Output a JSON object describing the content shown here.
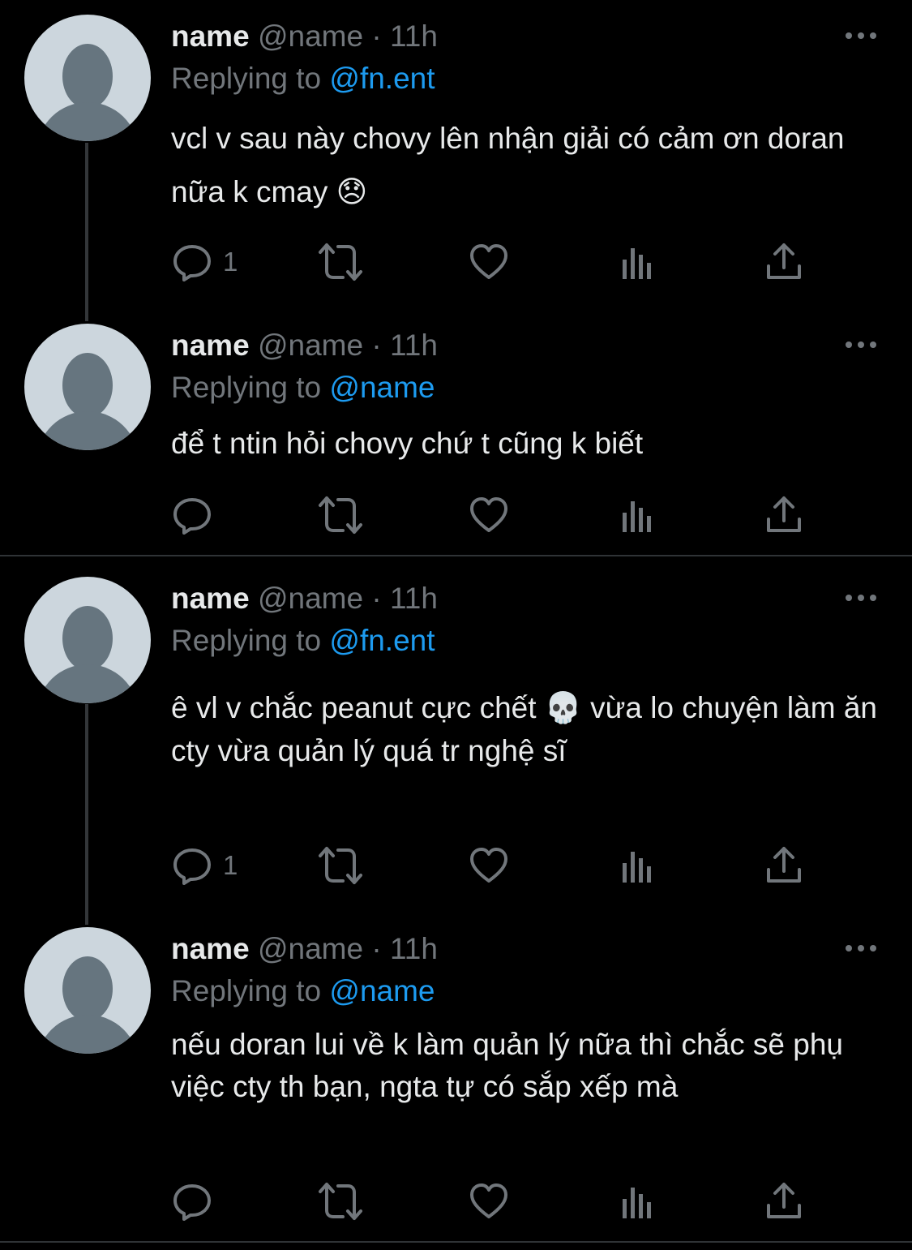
{
  "tweets": [
    {
      "name": "name",
      "handle": "@name",
      "separator": "·",
      "time": "11h",
      "replying_prefix": "Replying to",
      "replying_to": "@fn.ent",
      "text": "vcl v sau này chovy lên nhận giải có cảm ơn doran nữa k cmay 😞",
      "reply_count": "1"
    },
    {
      "name": "name",
      "handle": "@name",
      "separator": "·",
      "time": "11h",
      "replying_prefix": "Replying to",
      "replying_to": "@name",
      "text": "để t ntin hỏi chovy chứ t cũng k biết",
      "reply_count": ""
    },
    {
      "name": "name",
      "handle": "@name",
      "separator": "·",
      "time": "11h",
      "replying_prefix": "Replying to",
      "replying_to": "@fn.ent",
      "text": "ê vl v chắc peanut cực chết 💀  vừa lo chuyện làm ăn cty vừa quản lý quá tr nghệ sĩ",
      "reply_count": "1"
    },
    {
      "name": "name",
      "handle": "@name",
      "separator": "·",
      "time": "11h",
      "replying_prefix": "Replying to",
      "replying_to": "@name",
      "text": "nếu doran lui về k làm quản lý nữa thì chắc sẽ phụ việc cty th bạn, ngta tự có sắp xếp mà",
      "reply_count": ""
    }
  ],
  "icons": [
    "more-icon",
    "reply-icon",
    "retweet-icon",
    "like-icon",
    "views-icon",
    "share-icon"
  ],
  "colors": {
    "background": "#000000",
    "text": "#e7e9ea",
    "secondary": "#71767b",
    "link": "#1d9bf0",
    "avatar_bg": "#ccd6dd",
    "avatar_figure": "#66757f"
  }
}
